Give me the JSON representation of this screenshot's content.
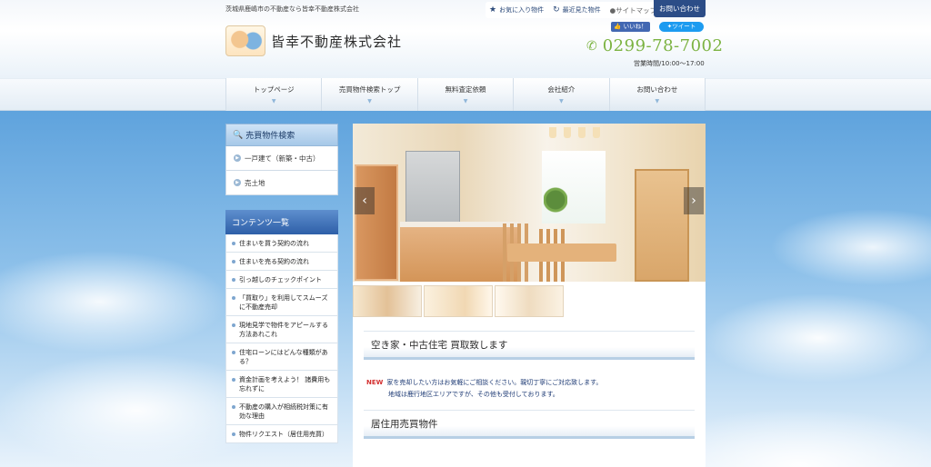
{
  "header": {
    "tagline": "茨城県鹿嶋市の不動産なら皆幸不動産株式会社",
    "company_name": "皆幸不動産株式会社",
    "top_links": [
      {
        "icon": "star-icon",
        "label": "お気に入り物件"
      },
      {
        "icon": "history-icon",
        "label": "最近見た物件"
      }
    ],
    "sitemap_label": "●サイトマップ",
    "contact_label": "お問い合わせ",
    "facebook_label": "いいね！",
    "twitter_label": "ツイート",
    "phone": "0299-78-7002",
    "hours": "営業時間/10:00〜17:00"
  },
  "nav": {
    "items": [
      {
        "label": "トップページ"
      },
      {
        "label": "売買物件検索トップ"
      },
      {
        "label": "無料査定依頼"
      },
      {
        "label": "会社紹介"
      },
      {
        "label": "お問い合わせ"
      }
    ]
  },
  "sidebar": {
    "search_title": "売買物件検索",
    "search_items": [
      {
        "label": "一戸建て（新築・中古）"
      },
      {
        "label": "売土地"
      }
    ],
    "contents_title": "コンテンツ一覧",
    "contents_items": [
      {
        "label": "住まいを買う契約の流れ"
      },
      {
        "label": "住まいを売る契約の流れ"
      },
      {
        "label": "引っ越しのチェックポイント"
      },
      {
        "label": "「買取り」を利用してスムーズに不動産売却"
      },
      {
        "label": "現地見学で物件をアピールする方法あれこれ"
      },
      {
        "label": "住宅ローンにはどんな種類がある？"
      },
      {
        "label": "資金計画を考えよう！ 諸費用も忘れずに"
      },
      {
        "label": "不動産の購入が相続税対策に有効な理由"
      },
      {
        "label": "物件リクエスト（居住用売買）"
      }
    ]
  },
  "main": {
    "section1_title": "空き家・中古住宅 買取致します",
    "news_badge": "NEW",
    "news_line1": "家を売却したい方はお気軽にご相談ください。親切丁寧にご対応致します。",
    "news_line2": "地域は鹿行地区エリアですが、その他も受付しております。",
    "section2_title": "居住用売買物件"
  }
}
